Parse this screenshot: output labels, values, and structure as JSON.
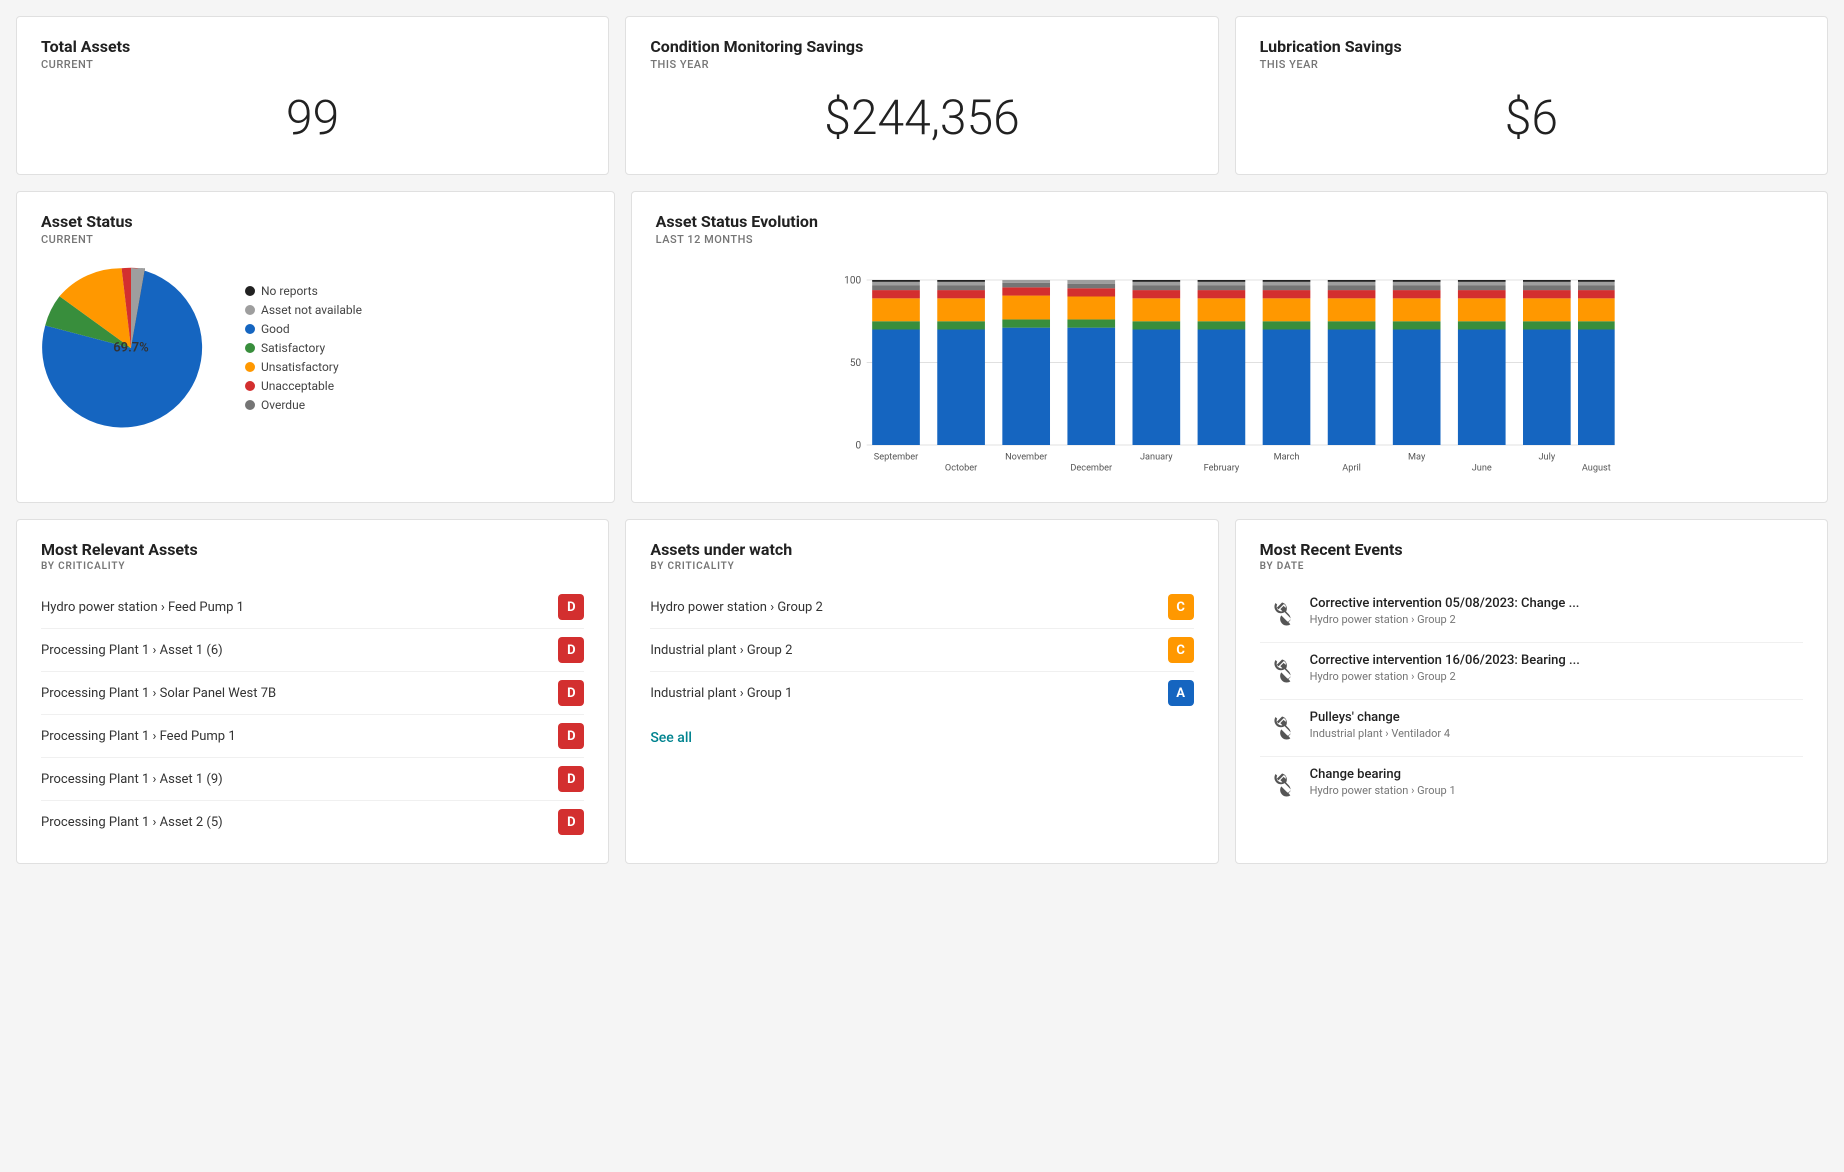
{
  "cards": {
    "total_assets": {
      "title": "Total Assets",
      "subtitle": "CURRENT",
      "value": "99"
    },
    "condition_savings": {
      "title": "Condition Monitoring Savings",
      "subtitle": "THIS YEAR",
      "value": "$244,356"
    },
    "lubrication_savings": {
      "title": "Lubrication Savings",
      "subtitle": "THIS YEAR",
      "value": "$6"
    }
  },
  "asset_status": {
    "title": "Asset Status",
    "subtitle": "CURRENT",
    "pie_label": "69.7%",
    "legend": [
      {
        "label": "No reports",
        "color": "#212121"
      },
      {
        "label": "Asset not available",
        "color": "#9e9e9e"
      },
      {
        "label": "Good",
        "color": "#1565c0"
      },
      {
        "label": "Satisfactory",
        "color": "#388e3c"
      },
      {
        "label": "Unsatisfactory",
        "color": "#ff9800"
      },
      {
        "label": "Unacceptable",
        "color": "#d32f2f"
      },
      {
        "label": "Overdue",
        "color": "#757575"
      }
    ]
  },
  "asset_evolution": {
    "title": "Asset Status Evolution",
    "subtitle": "LAST 12 MONTHS",
    "months": [
      "September",
      "October",
      "November",
      "December",
      "January",
      "February",
      "March",
      "April",
      "May",
      "June",
      "July",
      "August"
    ],
    "y_labels": [
      "0",
      "50",
      "100"
    ]
  },
  "most_relevant": {
    "title": "Most Relevant Assets",
    "section_label": "BY CRITICALITY",
    "items": [
      {
        "path": "Hydro power station › Feed Pump 1",
        "badge": "D",
        "badge_class": "badge-d"
      },
      {
        "path": "Processing Plant 1 › Asset 1 (6)",
        "badge": "D",
        "badge_class": "badge-d"
      },
      {
        "path": "Processing Plant 1 › Solar Panel West 7B",
        "badge": "D",
        "badge_class": "badge-d"
      },
      {
        "path": "Processing Plant 1 › Feed Pump 1",
        "badge": "D",
        "badge_class": "badge-d"
      },
      {
        "path": "Processing Plant 1 › Asset 1 (9)",
        "badge": "D",
        "badge_class": "badge-d"
      },
      {
        "path": "Processing Plant 1 › Asset 2 (5)",
        "badge": "D",
        "badge_class": "badge-d"
      }
    ]
  },
  "assets_watch": {
    "title": "Assets under watch",
    "section_label": "BY CRITICALITY",
    "items": [
      {
        "path": "Hydro power station › Group 2",
        "badge": "C",
        "badge_class": "badge-c"
      },
      {
        "path": "Industrial plant › Group 2",
        "badge": "C",
        "badge_class": "badge-c"
      },
      {
        "path": "Industrial plant › Group 1",
        "badge": "A",
        "badge_class": "badge-a"
      }
    ],
    "see_all": "See all"
  },
  "recent_events": {
    "title": "Most Recent Events",
    "section_label": "BY DATE",
    "items": [
      {
        "title": "Corrective intervention 05/08/2023: Change ...",
        "sub": "Hydro power station › Group 2"
      },
      {
        "title": "Corrective intervention 16/06/2023: Bearing ...",
        "sub": "Hydro power station › Group 2"
      },
      {
        "title": "Pulleys' change",
        "sub": "Industrial plant › Ventilador 4"
      },
      {
        "title": "Change bearing",
        "sub": "Hydro power station › Group 1"
      }
    ]
  }
}
